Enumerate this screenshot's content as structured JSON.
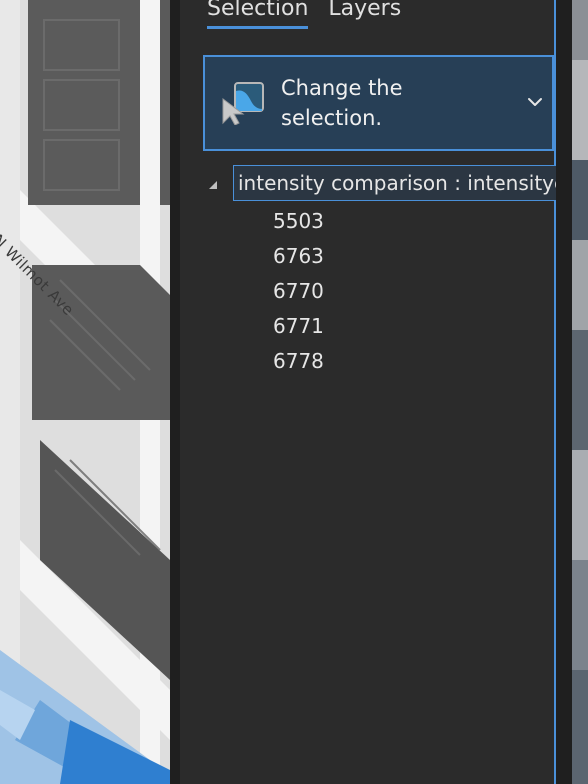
{
  "map": {
    "street_label": "N Wilmot Ave"
  },
  "tabs": [
    {
      "label": "Selection",
      "active": true
    },
    {
      "label": "Layers",
      "active": false
    }
  ],
  "change_selection": {
    "label": "Change the selection.",
    "icon": "change-selection-icon",
    "chevron_icon": "chevron-down-icon"
  },
  "tree": {
    "expanded": true,
    "layer_label": "intensity comparison : intensitye",
    "items": [
      "5503",
      "6763",
      "6770",
      "6771",
      "6778"
    ]
  },
  "colors": {
    "accent": "#4a90d9",
    "pane_bg": "#2b2b2b",
    "card_bg": "#273f56"
  }
}
